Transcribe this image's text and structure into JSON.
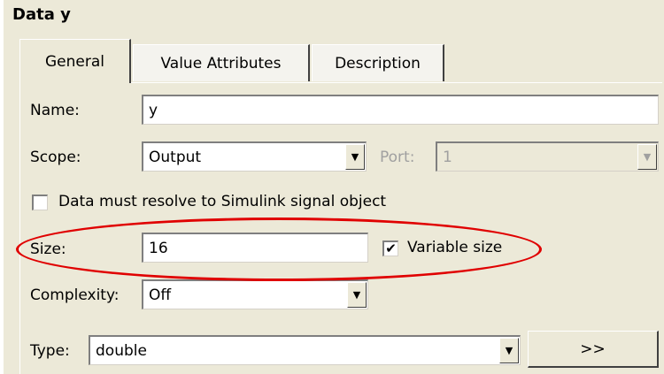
{
  "title": "Data y",
  "tabs": [
    {
      "label": "General",
      "active": true
    },
    {
      "label": "Value Attributes",
      "active": false
    },
    {
      "label": "Description",
      "active": false
    }
  ],
  "form": {
    "name_label": "Name:",
    "name_value": "y",
    "scope_label": "Scope:",
    "scope_value": "Output",
    "port_label": "Port:",
    "port_value": "1",
    "resolve_label": "Data must resolve to Simulink signal object",
    "resolve_checked": false,
    "size_label": "Size:",
    "size_value": "16",
    "variable_size_label": "Variable size",
    "variable_size_checked": true,
    "variable_size_mark": "✔",
    "complexity_label": "Complexity:",
    "complexity_value": "Off",
    "type_label": "Type:",
    "type_value": "double",
    "type_button_label": ">>"
  },
  "icons": {
    "dropdown_arrow": "▼"
  },
  "colors": {
    "dialog_bg": "#ece9d8",
    "highlight": "#e00000"
  }
}
